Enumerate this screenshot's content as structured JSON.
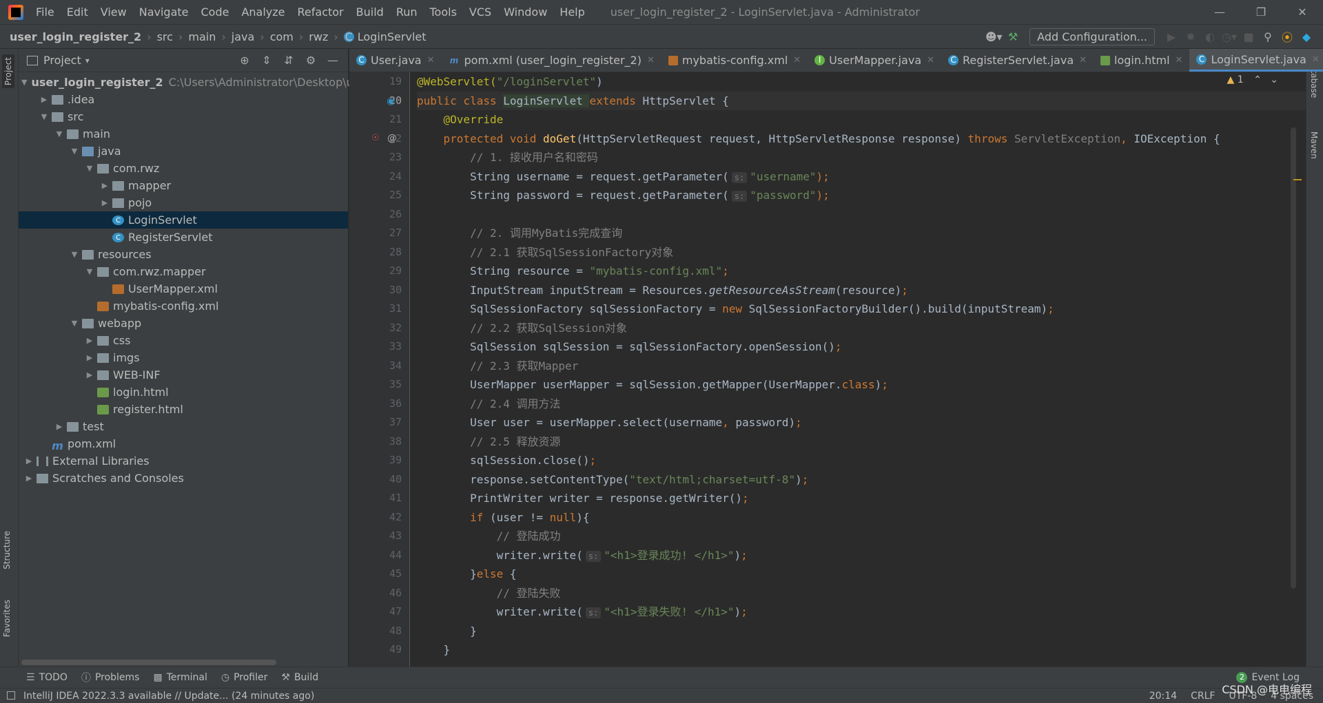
{
  "menubar": {
    "items": [
      "File",
      "Edit",
      "View",
      "Navigate",
      "Code",
      "Analyze",
      "Refactor",
      "Build",
      "Run",
      "Tools",
      "VCS",
      "Window",
      "Help"
    ],
    "window_title": "user_login_register_2 - LoginServlet.java - Administrator"
  },
  "navbar": {
    "crumbs": [
      "user_login_register_2",
      "src",
      "main",
      "java",
      "com",
      "rwz",
      "LoginServlet"
    ],
    "add_configuration": "Add Configuration..."
  },
  "project_panel": {
    "title": "Project",
    "rows": [
      {
        "label": "user_login_register_2",
        "path": "C:\\Users\\Administrator\\Desktop\\use"
      },
      {
        "label": ".idea"
      },
      {
        "label": "src"
      },
      {
        "label": "main"
      },
      {
        "label": "java"
      },
      {
        "label": "com.rwz"
      },
      {
        "label": "mapper"
      },
      {
        "label": "pojo"
      },
      {
        "label": "LoginServlet"
      },
      {
        "label": "RegisterServlet"
      },
      {
        "label": "resources"
      },
      {
        "label": "com.rwz.mapper"
      },
      {
        "label": "UserMapper.xml"
      },
      {
        "label": "mybatis-config.xml"
      },
      {
        "label": "webapp"
      },
      {
        "label": "css"
      },
      {
        "label": "imgs"
      },
      {
        "label": "WEB-INF"
      },
      {
        "label": "login.html"
      },
      {
        "label": "register.html"
      },
      {
        "label": "test"
      },
      {
        "label": "pom.xml"
      },
      {
        "label": "External Libraries"
      },
      {
        "label": "Scratches and Consoles"
      }
    ]
  },
  "side_tools": {
    "project": "Project",
    "structure": "Structure",
    "favorites": "Favorites",
    "database": "Database",
    "maven": "Maven"
  },
  "tabs": [
    "User.java",
    "pom.xml (user_login_register_2)",
    "mybatis-config.xml",
    "UserMapper.java",
    "RegisterServlet.java",
    "login.html",
    "LoginServlet.java"
  ],
  "editor": {
    "warning_count": "1",
    "line_numbers": [
      "19",
      "20",
      "21",
      "22",
      "23",
      "24",
      "25",
      "26",
      "27",
      "28",
      "29",
      "30",
      "31",
      "32",
      "33",
      "34",
      "35",
      "36",
      "37",
      "38",
      "39",
      "40",
      "41",
      "42",
      "43",
      "44",
      "45",
      "46",
      "47",
      "48",
      "49"
    ],
    "hint_label": "s:",
    "code": {
      "l19a": "@WebServlet(",
      "l19b": "\"/loginServlet\"",
      "l19c": ")",
      "l20a": "public class ",
      "l20b": "LoginServlet ",
      "l20c": "extends ",
      "l20d": "HttpServlet {",
      "l21": "    @Override",
      "l22a": "    protected void ",
      "l22b": "doGet",
      "l22c": "(HttpServletRequest request, HttpServletResponse response) ",
      "l22d": "throws ",
      "l22e": "ServletException",
      "l22f": ", ",
      "l22g": "IOException {",
      "l23": "        // 1. 接收用户名和密码",
      "l24a": "        String username = request.getParameter(",
      "l24b": "\"username\"",
      "l24c": ");",
      "l25a": "        String password = request.getParameter(",
      "l25b": "\"password\"",
      "l25c": ");",
      "l27": "        // 2. 调用MyBatis完成查询",
      "l28": "        // 2.1 获取SqlSessionFactory对象",
      "l29a": "        String resource = ",
      "l29b": "\"mybatis-config.xml\"",
      "l29c": ";",
      "l30a": "        InputStream inputStream = Resources.",
      "l30b": "getResourceAsStream",
      "l30c": "(resource)",
      "l30d": ";",
      "l31a": "        SqlSessionFactory sqlSessionFactory = ",
      "l31b": "new ",
      "l31c": "SqlSessionFactoryBuilder().build(inputStream)",
      "l31d": ";",
      "l32": "        // 2.2 获取SqlSession对象",
      "l33a": "        SqlSession sqlSession = sqlSessionFactory.openSession()",
      "l33b": ";",
      "l34": "        // 2.3 获取Mapper",
      "l35a": "        UserMapper userMapper = sqlSession.getMapper(UserMapper.",
      "l35b": "class",
      "l35c": ")",
      "l35d": ";",
      "l36": "        // 2.4 调用方法",
      "l37a": "        User user = userMapper.select(username",
      "l37b": ", ",
      "l37c": "password)",
      "l37d": ";",
      "l38": "        // 2.5 释放资源",
      "l39a": "        sqlSession.close()",
      "l39b": ";",
      "l40a": "        response.setContentType(",
      "l40b": "\"text/html;charset=utf-8\"",
      "l40c": ")",
      "l40d": ";",
      "l41a": "        PrintWriter writer = response.getWriter()",
      "l41b": ";",
      "l42a": "        ",
      "l42b": "if ",
      "l42c": "(user != ",
      "l42d": "null",
      "l42e": "){",
      "l43": "            // 登陆成功",
      "l44a": "            writer.write(",
      "l44b": "\"<h1>登录成功! </h1>\"",
      "l44c": ")",
      "l44d": ";",
      "l45a": "        }",
      "l45b": "else ",
      "l45c": "{",
      "l46": "            // 登陆失败",
      "l47a": "            writer.write(",
      "l47b": "\"<h1>登录失败! </h1>\"",
      "l47c": ")",
      "l47d": ";",
      "l48": "        }",
      "l49": "    }"
    }
  },
  "bottom_tools": {
    "todo": "TODO",
    "problems": "Problems",
    "terminal": "Terminal",
    "profiler": "Profiler",
    "build": "Build",
    "event_log": "Event Log",
    "event_count": "2"
  },
  "status": {
    "message": "IntelliJ IDEA 2022.3.3 available // Update... (24 minutes ago)",
    "position": "20:14",
    "line_sep": "CRLF",
    "encoding": "UTF-8",
    "indent": "4 spaces",
    "watermark": "CSDN @电电编程"
  }
}
